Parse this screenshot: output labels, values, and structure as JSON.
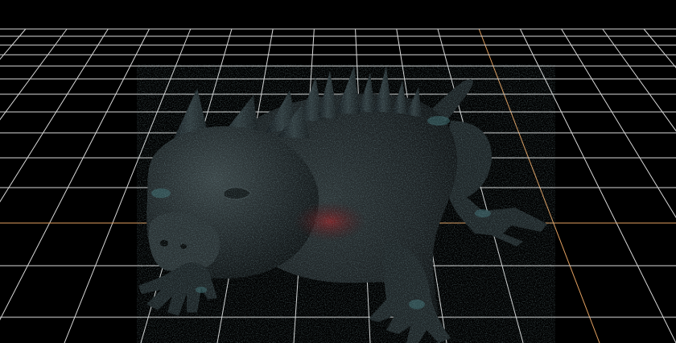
{
  "viewport": {
    "background_color": "#000000",
    "grid_color": "#d8d8d8",
    "axis_x_color": "#e2a060",
    "axis_z_color": "#e2a060",
    "model_name": "horned-lizard-creature-3d-model",
    "model_base_color": "#1d2224",
    "model_highlight_color": "#3d6b70",
    "model_accent_color": "#7a1f22"
  }
}
